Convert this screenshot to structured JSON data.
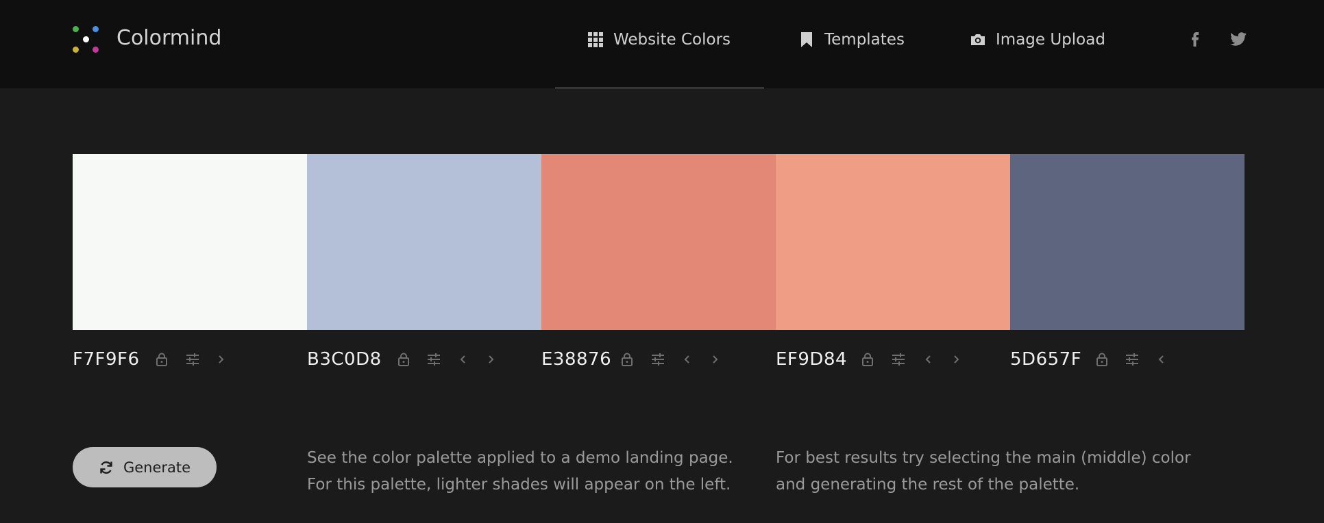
{
  "nav": {
    "brand": "Colormind",
    "items": [
      {
        "label": "Website Colors",
        "icon": "grid-icon",
        "active": true
      },
      {
        "label": "Templates",
        "icon": "bookmark-icon",
        "active": false
      },
      {
        "label": "Image Upload",
        "icon": "camera-icon",
        "active": false
      }
    ],
    "social": [
      "facebook-icon",
      "twitter-icon"
    ]
  },
  "palette": [
    {
      "hex": "F7F9F6",
      "color": "#F7F9F6"
    },
    {
      "hex": "B3C0D8",
      "color": "#B3C0D8"
    },
    {
      "hex": "E38876",
      "color": "#E38876"
    },
    {
      "hex": "EF9D84",
      "color": "#EF9D84"
    },
    {
      "hex": "5D657F",
      "color": "#5D657F"
    }
  ],
  "generate_label": "Generate",
  "info": {
    "demo_line1": "See the color palette applied to a demo landing page.",
    "demo_line2": "For this palette, lighter shades will appear on the left.",
    "tip_line1": "For best results try selecting the main (middle) color",
    "tip_line2": "and generating the rest of the palette."
  },
  "colors": {
    "background": "#1b1b1b",
    "navbar": "#0f0f0f",
    "button": "#bdbdbd",
    "muted_text": "#9a9a9a",
    "icon_gray": "#6f6f6f"
  }
}
